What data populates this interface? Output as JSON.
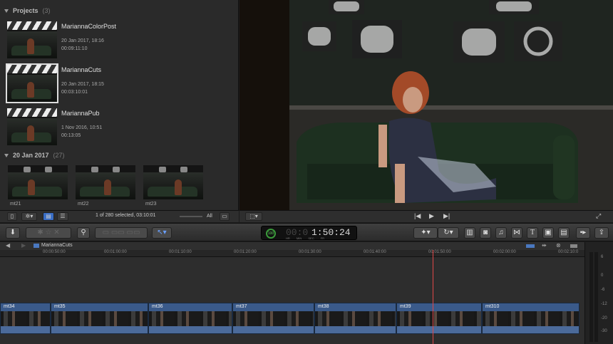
{
  "browser": {
    "projects_label": "Projects",
    "projects_count": "(3)",
    "projects": [
      {
        "title": "MariannaColorPost",
        "date": "20 Jan 2017, 18:16",
        "duration": "00:09:11:10"
      },
      {
        "title": "MariannaCuts",
        "date": "20 Jan 2017, 18:15",
        "duration": "00:03:10:01"
      },
      {
        "title": "MariannaPub",
        "date": "1 Nov 2016, 10:51",
        "duration": "00:13:05"
      }
    ],
    "event_label": "20 Jan 2017",
    "event_count": "(27)",
    "clips": [
      "mt21",
      "mt22",
      "mt23"
    ],
    "status": "1 of 280 selected, 03:10:01",
    "filter": "All"
  },
  "toolbar": {
    "timecode": "1:50:24",
    "timecode_prefix": "00:0",
    "timecode_units": [
      "HR",
      "MIN",
      "SEC",
      "FR"
    ],
    "timecode_badge": "100"
  },
  "timeline": {
    "project_name": "MariannaCuts",
    "ruler": [
      "00:00:50:00",
      "00:01:00:00",
      "00:01:10:00",
      "00:01:20:00",
      "00:01:30:00",
      "00:01:40:00",
      "00:01:50:00",
      "00:02:00:00",
      "00:02:10:0"
    ],
    "clips": [
      "mt34",
      "mt35",
      "mt36",
      "mt37",
      "mt38",
      "mt39",
      "mt310"
    ],
    "meter_labels": [
      "6",
      "0",
      "-6",
      "-12",
      "-20",
      "-30"
    ]
  },
  "colors": {
    "accent": "#3a6ec6",
    "playhead": "#e04848",
    "clip": "#3a5a8a"
  }
}
